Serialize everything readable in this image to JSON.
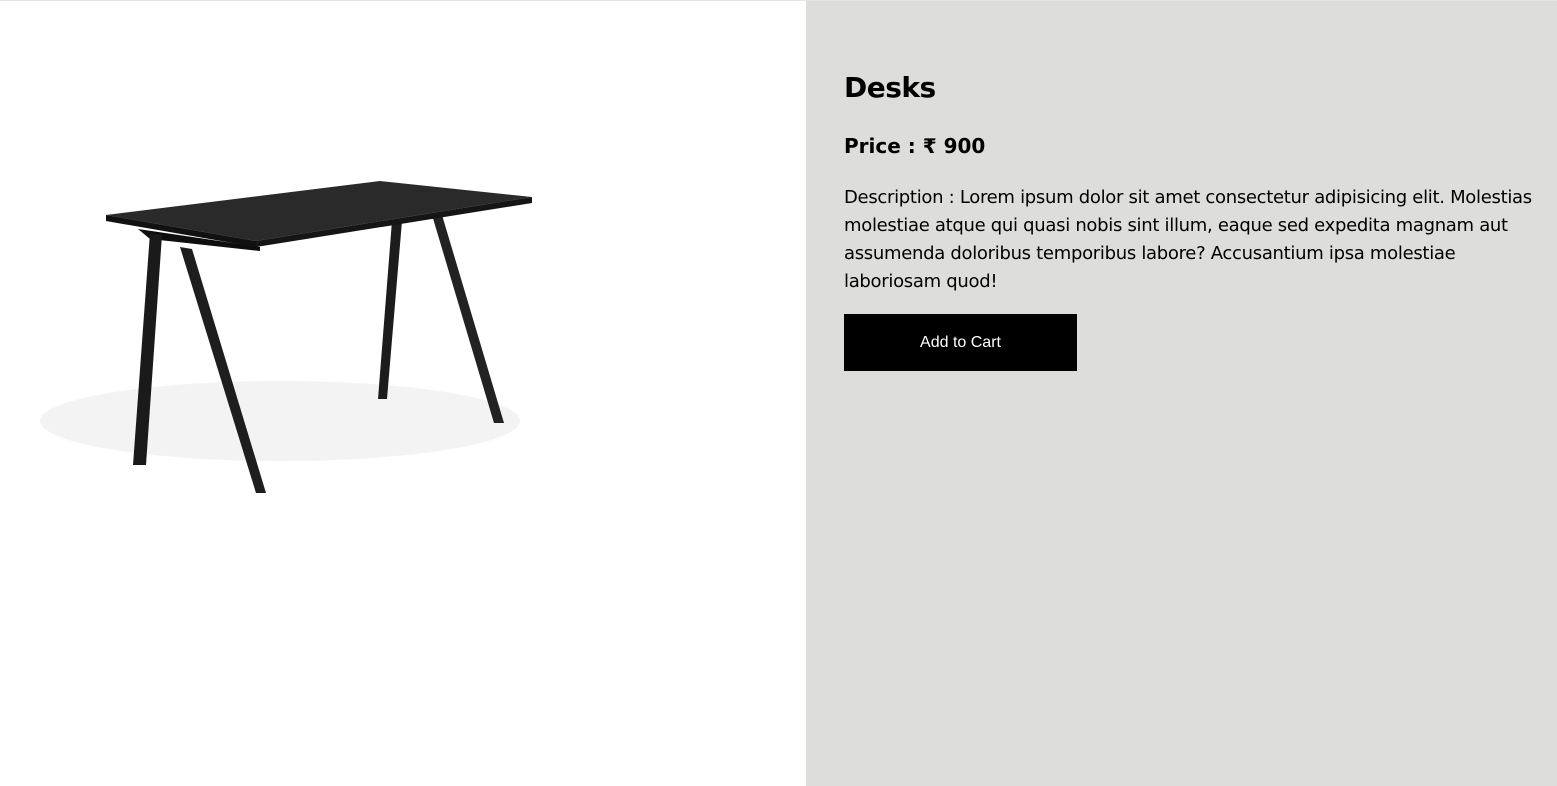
{
  "product": {
    "title": "Desks",
    "price_label": "Price : ₹ 900",
    "description": "Description : Lorem ipsum dolor sit amet consectetur adipisicing elit. Molestias molestiae atque qui quasi nobis sint illum, eaque sed expedita magnam aut assumenda doloribus temporibus labore? Accusantium ipsa molestiae laboriosam quod!",
    "add_to_cart_label": "Add to Cart",
    "image_icon": "desk-product-image"
  },
  "colors": {
    "info_background": "#dddddc",
    "button_background": "#000000",
    "button_text": "#ffffff"
  }
}
